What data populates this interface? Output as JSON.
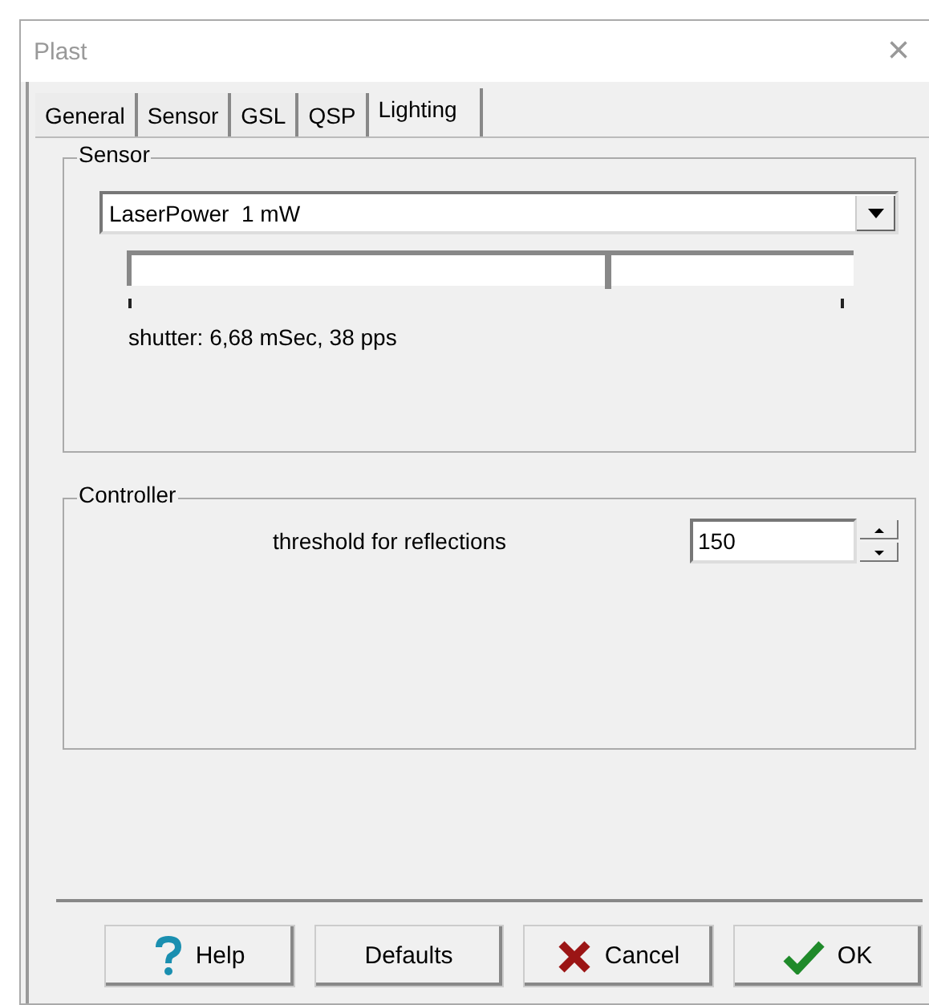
{
  "window": {
    "title": "Plast",
    "close": "×"
  },
  "tabs": [
    {
      "label": "General",
      "selected": false
    },
    {
      "label": "Sensor",
      "selected": false
    },
    {
      "label": "GSL",
      "selected": false
    },
    {
      "label": "QSP",
      "selected": false
    },
    {
      "label": "Lighting",
      "selected": true
    }
  ],
  "sensor": {
    "title": "Sensor",
    "dropdown": {
      "value": "LaserPower  1 mW"
    },
    "slider": {
      "level": 0.66
    },
    "status": "shutter: 6,68 mSec, 38 pps"
  },
  "controller": {
    "title": "Controller",
    "label": "threshold for reflections",
    "spin": {
      "value": "150"
    }
  },
  "buttons": [
    {
      "kind": "help",
      "label": "Help"
    },
    {
      "kind": "plain",
      "label": "Defaults"
    },
    {
      "kind": "cancel",
      "label": "Cancel"
    },
    {
      "kind": "ok",
      "label": "OK"
    }
  ]
}
